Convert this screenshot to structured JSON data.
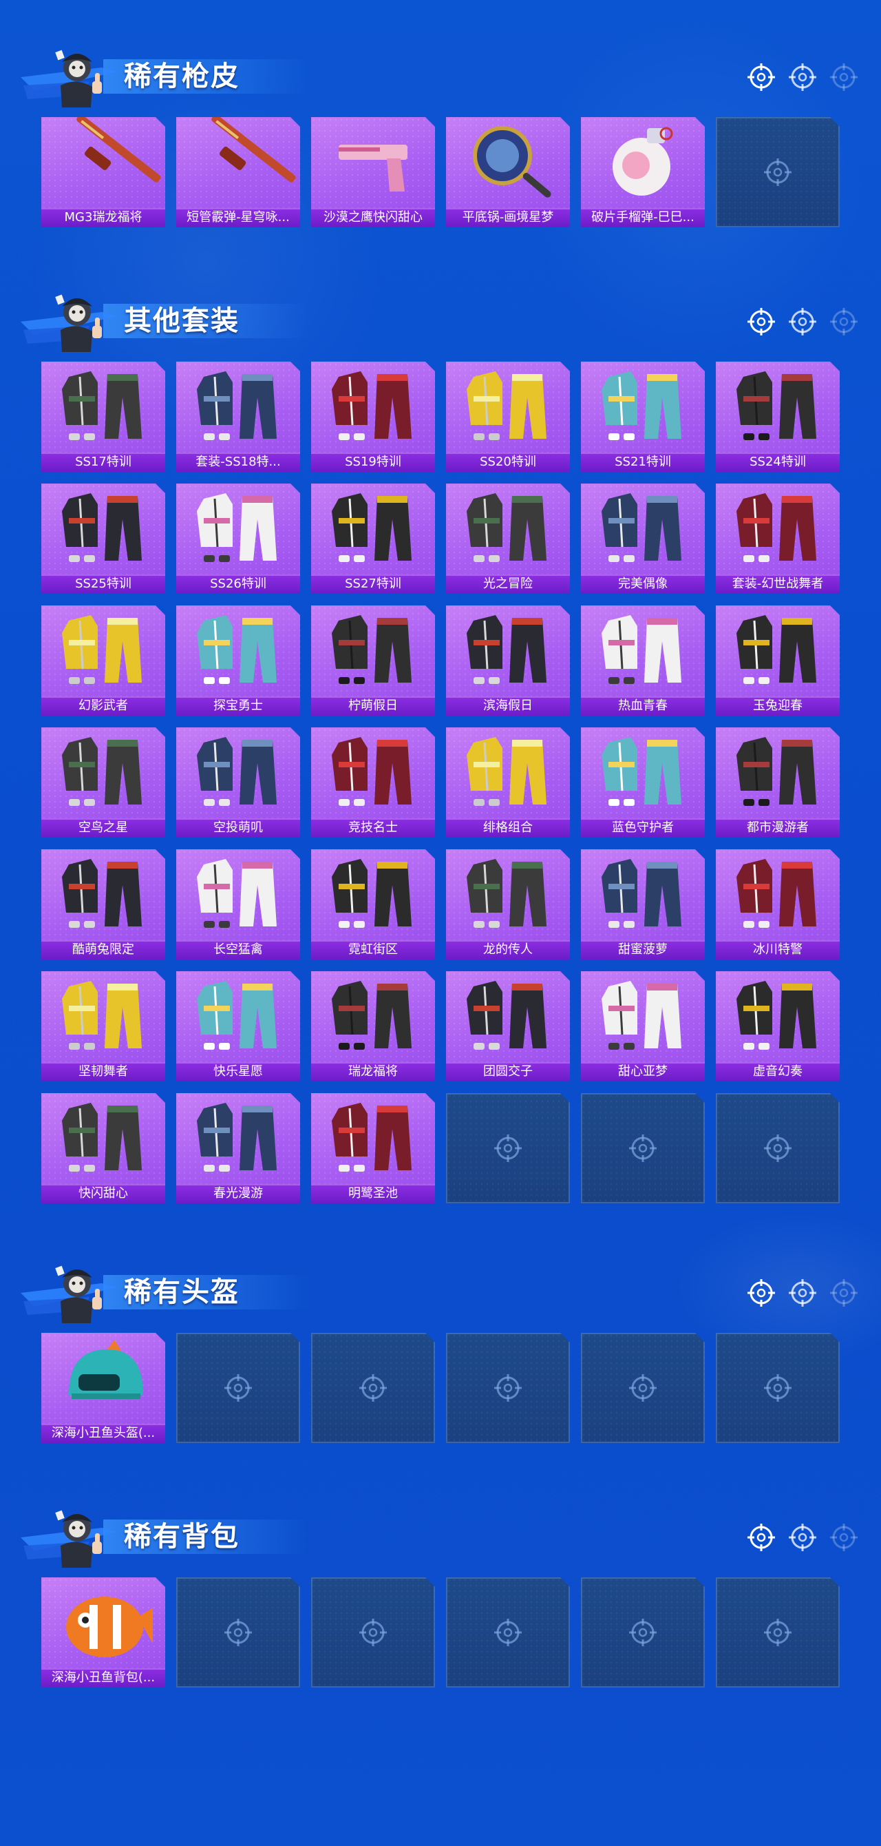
{
  "sections": [
    {
      "title": "稀有枪皮",
      "items": [
        {
          "label": "MG3瑞龙福将",
          "icon": "gun-icon"
        },
        {
          "label": "短管霰弹-星穹咏...",
          "icon": "shotgun-icon"
        },
        {
          "label": "沙漠之鹰快闪甜心",
          "icon": "pistol-icon"
        },
        {
          "label": "平底锅-画境星梦",
          "icon": "pan-icon"
        },
        {
          "label": "破片手榴弹-巳巳...",
          "icon": "grenade-icon"
        },
        {
          "label": "",
          "icon": "empty-slot-icon"
        }
      ]
    },
    {
      "title": "其他套装",
      "items": [
        {
          "label": "SS17特训",
          "icon": "outfit-icon"
        },
        {
          "label": "套装-SS18特...",
          "icon": "outfit-icon"
        },
        {
          "label": "SS19特训",
          "icon": "outfit-icon"
        },
        {
          "label": "SS20特训",
          "icon": "outfit-icon"
        },
        {
          "label": "SS21特训",
          "icon": "outfit-icon"
        },
        {
          "label": "SS24特训",
          "icon": "outfit-icon"
        },
        {
          "label": "SS25特训",
          "icon": "outfit-icon"
        },
        {
          "label": "SS26特训",
          "icon": "outfit-icon"
        },
        {
          "label": "SS27特训",
          "icon": "outfit-icon"
        },
        {
          "label": "光之冒险",
          "icon": "outfit-icon"
        },
        {
          "label": "完美偶像",
          "icon": "outfit-icon"
        },
        {
          "label": "套装-幻世战舞者",
          "icon": "outfit-icon"
        },
        {
          "label": "幻影武者",
          "icon": "outfit-icon"
        },
        {
          "label": "探宝勇士",
          "icon": "outfit-icon"
        },
        {
          "label": "柠萌假日",
          "icon": "outfit-icon"
        },
        {
          "label": "滨海假日",
          "icon": "outfit-icon"
        },
        {
          "label": "热血青春",
          "icon": "outfit-icon"
        },
        {
          "label": "玉兔迎春",
          "icon": "outfit-icon"
        },
        {
          "label": "空鸟之星",
          "icon": "outfit-icon"
        },
        {
          "label": "空投萌叽",
          "icon": "outfit-icon"
        },
        {
          "label": "竞技名士",
          "icon": "outfit-icon"
        },
        {
          "label": "绯格组合",
          "icon": "outfit-icon"
        },
        {
          "label": "蓝色守护者",
          "icon": "outfit-icon"
        },
        {
          "label": "都市漫游者",
          "icon": "outfit-icon"
        },
        {
          "label": "酷萌兔限定",
          "icon": "outfit-icon"
        },
        {
          "label": "长空猛禽",
          "icon": "outfit-icon"
        },
        {
          "label": "霓虹街区",
          "icon": "outfit-icon"
        },
        {
          "label": "龙的传人",
          "icon": "outfit-icon"
        },
        {
          "label": "甜蜜菠萝",
          "icon": "outfit-icon"
        },
        {
          "label": "冰川特警",
          "icon": "outfit-icon"
        },
        {
          "label": "坚韧舞者",
          "icon": "outfit-icon"
        },
        {
          "label": "快乐星愿",
          "icon": "outfit-icon"
        },
        {
          "label": "瑞龙福将",
          "icon": "outfit-icon"
        },
        {
          "label": "团圆交子",
          "icon": "outfit-icon"
        },
        {
          "label": "甜心亚梦",
          "icon": "outfit-icon"
        },
        {
          "label": "虚音幻奏",
          "icon": "outfit-icon"
        },
        {
          "label": "快闪甜心",
          "icon": "outfit-icon"
        },
        {
          "label": "春光漫游",
          "icon": "outfit-icon"
        },
        {
          "label": "明鹭圣池",
          "icon": "outfit-icon"
        },
        {
          "label": "",
          "icon": "empty-slot-icon"
        },
        {
          "label": "",
          "icon": "empty-slot-icon"
        },
        {
          "label": "",
          "icon": "empty-slot-icon"
        }
      ]
    },
    {
      "title": "稀有头盔",
      "items": [
        {
          "label": "深海小丑鱼头盔(...",
          "icon": "helmet-icon"
        },
        {
          "label": "",
          "icon": "empty-slot-icon"
        },
        {
          "label": "",
          "icon": "empty-slot-icon"
        },
        {
          "label": "",
          "icon": "empty-slot-icon"
        },
        {
          "label": "",
          "icon": "empty-slot-icon"
        },
        {
          "label": "",
          "icon": "empty-slot-icon"
        }
      ]
    },
    {
      "title": "稀有背包",
      "items": [
        {
          "label": "深海小丑鱼背包(...",
          "icon": "backpack-icon"
        },
        {
          "label": "",
          "icon": "empty-slot-icon"
        },
        {
          "label": "",
          "icon": "empty-slot-icon"
        },
        {
          "label": "",
          "icon": "empty-slot-icon"
        },
        {
          "label": "",
          "icon": "empty-slot-icon"
        },
        {
          "label": "",
          "icon": "empty-slot-icon"
        }
      ]
    }
  ],
  "colors": {
    "background": "#0b4fcf",
    "tile_purple": "#a85ef2",
    "label_purple": "#7a24d6",
    "empty_slot": "#1d4585"
  }
}
